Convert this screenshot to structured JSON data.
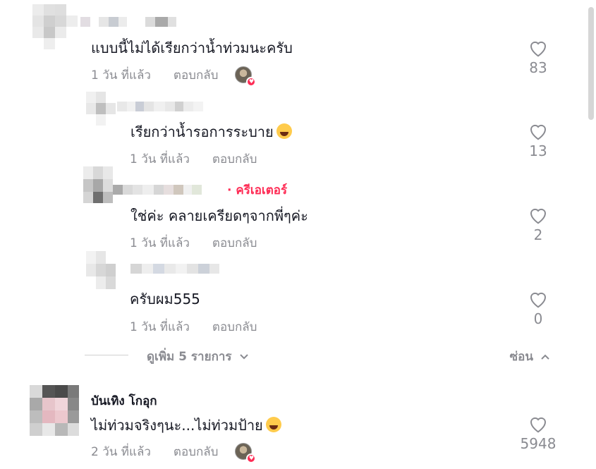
{
  "comments": [
    {
      "username": "",
      "text": "แบบนี้ไม่ได้เรียกว่าน้ำท่วมนะครับ",
      "time": "1 วัน ที่แล้ว",
      "reply_label": "ตอบกลับ",
      "likes": "83",
      "liked_by_creator": true
    },
    {
      "username": "",
      "text": "เรียกว่าน้ำรอการระบาย",
      "emoji": "grinning-sweat-emoji",
      "time": "1 วัน ที่แล้ว",
      "reply_label": "ตอบกลับ",
      "likes": "13"
    },
    {
      "username": "",
      "badge": "· ครีเอเตอร์",
      "text": "ใช่ค่ะ คลายเครียดๆจากพี่ๆค่ะ",
      "time": "1 วัน ที่แล้ว",
      "reply_label": "ตอบกลับ",
      "likes": "2"
    },
    {
      "username": "",
      "text": "ครับผม555",
      "time": "1 วัน ที่แล้ว",
      "reply_label": "ตอบกลับ",
      "likes": "0"
    },
    {
      "username": "บันเทิง โกอุก",
      "text": "ไม่ท่วมจริงๆนะ...ไม่ท่วมป้าย",
      "emoji": "rofl-emoji",
      "time": "2 วัน ที่แล้ว",
      "reply_label": "ตอบกลับ",
      "likes": "5948",
      "liked_by_creator": true
    }
  ],
  "view_more_label": "ดูเพิ่ม 5 รายการ",
  "hide_label": "ซ่อน",
  "colors": {
    "accent": "#fe2c55",
    "muted": "#8a8b91",
    "text": "#161823"
  }
}
